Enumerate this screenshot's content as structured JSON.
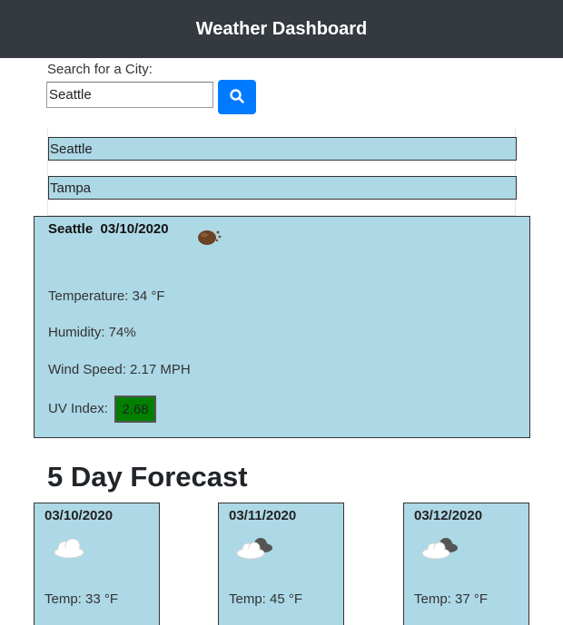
{
  "header": {
    "title": "Weather Dashboard"
  },
  "search": {
    "label": "Search for a City:",
    "value": "Seattle",
    "button_icon": "search-icon"
  },
  "history": [
    "Seattle",
    "Tampa"
  ],
  "current": {
    "city": "Seattle",
    "date": "03/10/2020",
    "icon": "dust-icon",
    "temperature": "Temperature: 34 °F",
    "humidity": "Humidity: 74%",
    "wind": "Wind Speed: 2.17 MPH",
    "uv_label": "UV Index:",
    "uv_value": "2.68",
    "uv_color": "#008000"
  },
  "forecast": {
    "title": "5 Day Forecast",
    "days": [
      {
        "date": "03/10/2020",
        "icon": "cloud-icon",
        "temp": "Temp: 33 °F"
      },
      {
        "date": "03/11/2020",
        "icon": "broken-clouds-icon",
        "temp": "Temp: 45 °F"
      },
      {
        "date": "03/12/2020",
        "icon": "broken-clouds-icon",
        "temp": "Temp: 37 °F"
      }
    ]
  },
  "colors": {
    "navbar": "#343a40",
    "accent": "#007bff",
    "card": "#add8e6"
  }
}
